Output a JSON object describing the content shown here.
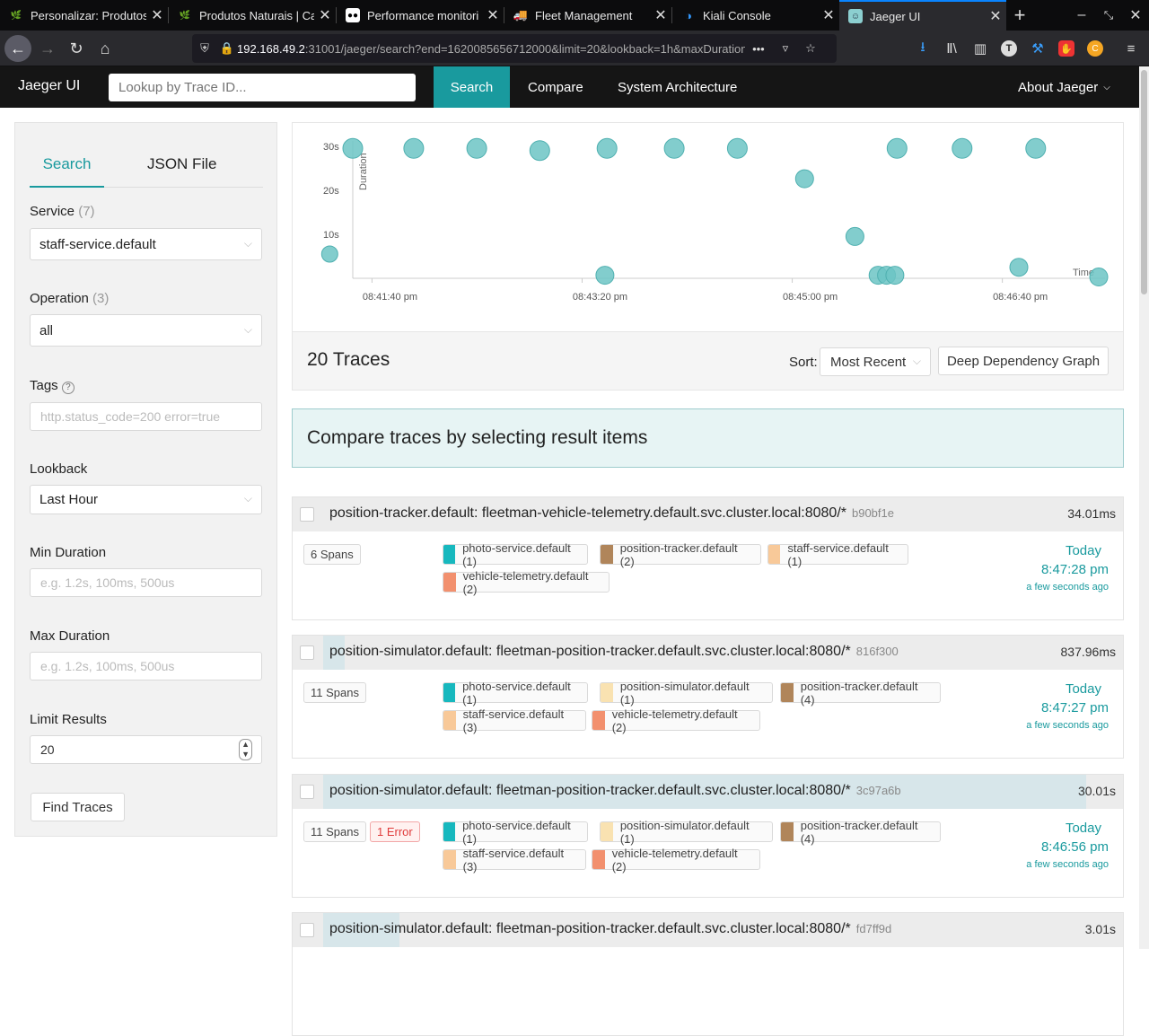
{
  "browser": {
    "tabs": [
      {
        "title": "Personalizar: Produtos",
        "icon": "leaf-icon"
      },
      {
        "title": "Produtos Naturais | Ca",
        "icon": "leaf-icon"
      },
      {
        "title": "Performance monitori",
        "icon": "medium-icon"
      },
      {
        "title": "Fleet Management",
        "icon": "truck-icon"
      },
      {
        "title": "Kiali Console",
        "icon": "kiali-icon"
      },
      {
        "title": "Jaeger UI",
        "icon": "jaeger-icon"
      }
    ],
    "url_host": "192.168.49.2",
    "url_path": ":31001/jaeger/search?end=1620085656712000&limit=20&lookback=1h&maxDuration&"
  },
  "app": {
    "brand": "Jaeger UI",
    "lookup_placeholder": "Lookup by Trace ID...",
    "nav": {
      "search": "Search",
      "compare": "Compare",
      "architecture": "System Architecture",
      "about": "About Jaeger"
    }
  },
  "form": {
    "tab_search": "Search",
    "tab_json": "JSON File",
    "service_label": "Service",
    "service_count": "(7)",
    "service_value": "staff-service.default",
    "operation_label": "Operation",
    "operation_count": "(3)",
    "operation_value": "all",
    "tags_label": "Tags",
    "tags_placeholder": "http.status_code=200 error=true",
    "lookback_label": "Lookback",
    "lookback_value": "Last Hour",
    "min_label": "Min Duration",
    "min_placeholder": "e.g. 1.2s, 100ms, 500us",
    "max_label": "Max Duration",
    "max_placeholder": "e.g. 1.2s, 100ms, 500us",
    "limit_label": "Limit Results",
    "limit_value": "20",
    "find_button": "Find Traces"
  },
  "chart_data": {
    "type": "scatter",
    "ylabel": "Duration",
    "xlabel": "Time",
    "yticks": [
      "30s",
      "20s",
      "10s"
    ],
    "xticks": [
      "08:41:40 pm",
      "08:43:20 pm",
      "08:45:00 pm",
      "08:46:40 pm"
    ],
    "x_unit": "seconds after 08:41:40 pm",
    "xlim": [
      -10,
      348
    ],
    "ylim": [
      0,
      32
    ],
    "points": [
      {
        "x": -21,
        "y": 5.5,
        "r": 9
      },
      {
        "x": -10,
        "y": 29.5,
        "r": 11
      },
      {
        "x": 19,
        "y": 29.5,
        "r": 11
      },
      {
        "x": 49,
        "y": 29.5,
        "r": 11
      },
      {
        "x": 79,
        "y": 29,
        "r": 11
      },
      {
        "x": 111,
        "y": 29.5,
        "r": 11
      },
      {
        "x": 110,
        "y": 0.7,
        "r": 10
      },
      {
        "x": 143,
        "y": 29.5,
        "r": 11
      },
      {
        "x": 173,
        "y": 29.5,
        "r": 11
      },
      {
        "x": 205,
        "y": 22.6,
        "r": 10
      },
      {
        "x": 229,
        "y": 9.5,
        "r": 10
      },
      {
        "x": 240,
        "y": 0.7,
        "r": 10
      },
      {
        "x": 244,
        "y": 0.7,
        "r": 10
      },
      {
        "x": 248,
        "y": 0.7,
        "r": 10
      },
      {
        "x": 249,
        "y": 29.5,
        "r": 11
      },
      {
        "x": 280,
        "y": 29.5,
        "r": 11
      },
      {
        "x": 307,
        "y": 2.5,
        "r": 10
      },
      {
        "x": 315,
        "y": 29.5,
        "r": 11
      },
      {
        "x": 345,
        "y": 0.3,
        "r": 10
      }
    ],
    "color": "#6cc4c4"
  },
  "results": {
    "count_label": "20 Traces",
    "sort_label": "Sort:",
    "sort_value": "Most Recent",
    "ddg_button": "Deep Dependency Graph",
    "compare_msg": "Compare traces by selecting result items"
  },
  "traces": [
    {
      "name": "position-tracker.default: fleetman-vehicle-telemetry.default.svc.cluster.local:8080/*",
      "id": "b90bf1e",
      "duration": "34.01ms",
      "bar_pct": 0.0,
      "spans": "6 Spans",
      "error": "",
      "services": [
        {
          "label": "photo-service.default (1)",
          "color": "#17b8be"
        },
        {
          "label": "position-tracker.default (2)",
          "color": "#b0855a"
        },
        {
          "label": "staff-service.default (1)",
          "color": "#f8c999"
        },
        {
          "label": "vehicle-telemetry.default (2)",
          "color": "#f2906e"
        }
      ],
      "day": "Today",
      "time": "8:47:28 pm",
      "ago": "a few seconds ago"
    },
    {
      "name": "position-simulator.default: fleetman-position-tracker.default.svc.cluster.local:8080/*",
      "id": "816f300",
      "duration": "837.96ms",
      "bar_pct": 2.8,
      "spans": "11 Spans",
      "error": "",
      "services": [
        {
          "label": "photo-service.default (1)",
          "color": "#17b8be"
        },
        {
          "label": "position-simulator.default (1)",
          "color": "#f9e2b1"
        },
        {
          "label": "position-tracker.default (4)",
          "color": "#b0855a"
        },
        {
          "label": "staff-service.default (3)",
          "color": "#f8c999"
        },
        {
          "label": "vehicle-telemetry.default (2)",
          "color": "#f2906e"
        }
      ],
      "day": "Today",
      "time": "8:47:27 pm",
      "ago": "a few seconds ago"
    },
    {
      "name": "position-simulator.default: fleetman-position-tracker.default.svc.cluster.local:8080/*",
      "id": "3c97a6b",
      "duration": "30.01s",
      "bar_pct": 100,
      "spans": "11 Spans",
      "error": "1 Error",
      "services": [
        {
          "label": "photo-service.default (1)",
          "color": "#17b8be"
        },
        {
          "label": "position-simulator.default (1)",
          "color": "#f9e2b1"
        },
        {
          "label": "position-tracker.default (4)",
          "color": "#b0855a"
        },
        {
          "label": "staff-service.default (3)",
          "color": "#f8c999"
        },
        {
          "label": "vehicle-telemetry.default (2)",
          "color": "#f2906e"
        }
      ],
      "day": "Today",
      "time": "8:46:56 pm",
      "ago": "a few seconds ago"
    },
    {
      "name": "position-simulator.default: fleetman-position-tracker.default.svc.cluster.local:8080/*",
      "id": "fd7ff9d",
      "duration": "3.01s",
      "bar_pct": 10,
      "spans": "",
      "error": "",
      "services": [],
      "day": "",
      "time": "",
      "ago": ""
    }
  ]
}
